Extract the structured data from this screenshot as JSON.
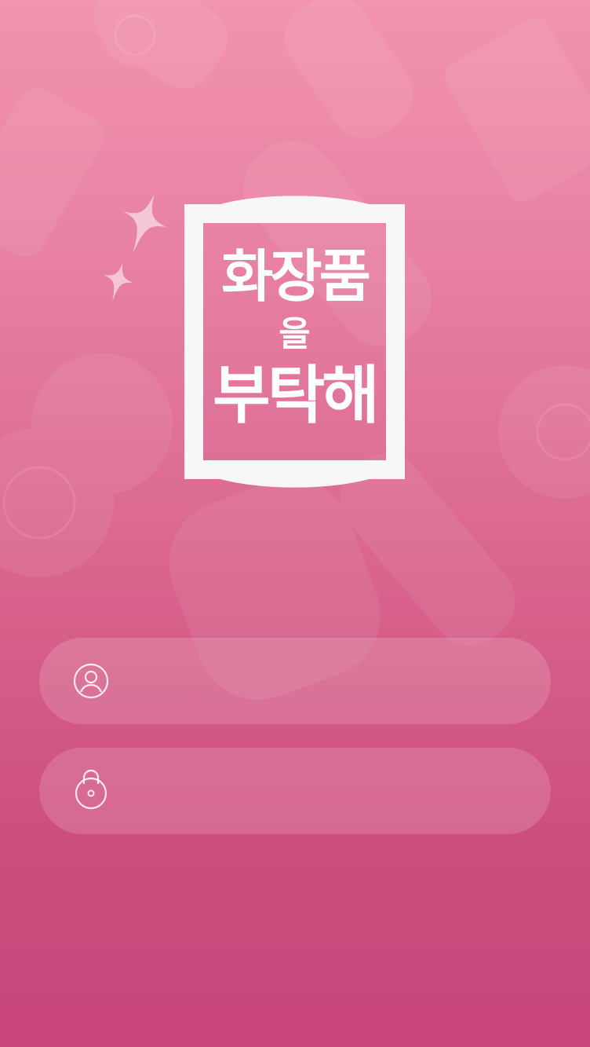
{
  "app": {
    "logo_line1": "화장품",
    "logo_line2": "을",
    "logo_line3": "부탁해"
  },
  "login": {
    "username": {
      "value": "",
      "placeholder": "",
      "icon": "user-icon"
    },
    "password": {
      "value": "",
      "placeholder": "",
      "icon": "lock-icon"
    }
  },
  "colors": {
    "gradient_top": "#f294ae",
    "gradient_bottom": "#c7457a",
    "logo_frame": "#f7f7f7"
  }
}
